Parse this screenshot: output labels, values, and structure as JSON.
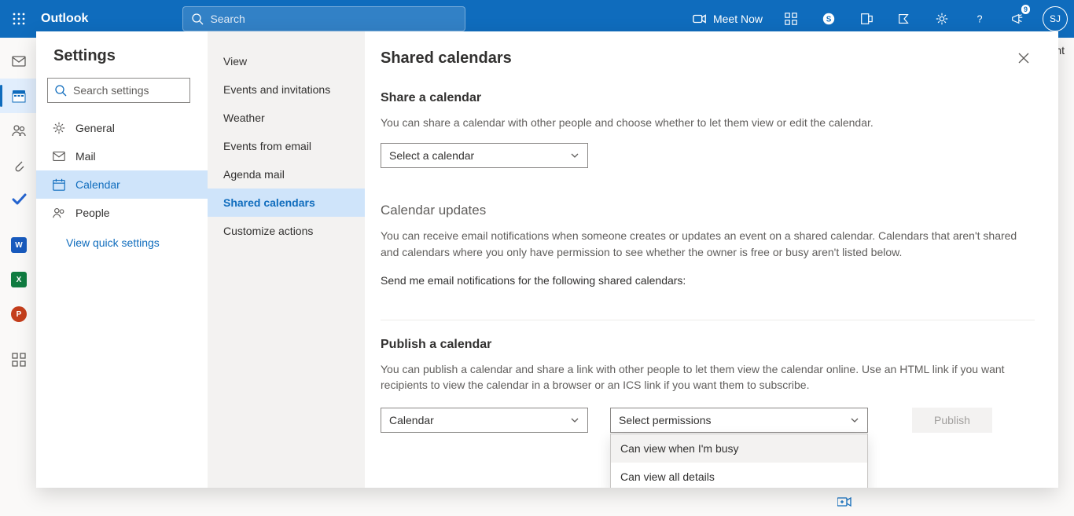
{
  "topbar": {
    "brand": "Outlook",
    "search_placeholder": "Search",
    "meet_now": "Meet Now",
    "notification_count": "9",
    "avatar_initials": "SJ"
  },
  "behind": {
    "print_label": "Print"
  },
  "settings": {
    "title": "Settings",
    "search_placeholder": "Search settings",
    "categories": [
      {
        "id": "general",
        "label": "General"
      },
      {
        "id": "mail",
        "label": "Mail"
      },
      {
        "id": "calendar",
        "label": "Calendar"
      },
      {
        "id": "people",
        "label": "People"
      }
    ],
    "quick_settings_link": "View quick settings",
    "sub_items": [
      "View",
      "Events and invitations",
      "Weather",
      "Events from email",
      "Agenda mail",
      "Shared calendars",
      "Customize actions"
    ],
    "selected_sub_index": 5
  },
  "panel": {
    "title": "Shared calendars",
    "share": {
      "heading": "Share a calendar",
      "desc": "You can share a calendar with other people and choose whether to let them view or edit the calendar.",
      "select_placeholder": "Select a calendar"
    },
    "updates": {
      "heading": "Calendar updates",
      "desc": "You can receive email notifications when someone creates or updates an event on a shared calendar. Calendars that aren't shared and calendars where you only have permission to see whether the owner is free or busy aren't listed below.",
      "prompt": "Send me email notifications for the following shared calendars:"
    },
    "publish": {
      "heading": "Publish a calendar",
      "desc": "You can publish a calendar and share a link with other people to let them view the calendar online. Use an HTML link if you want recipients to view the calendar in a browser or an ICS link if you want them to subscribe.",
      "calendar_selected": "Calendar",
      "permission_placeholder": "Select permissions",
      "permission_options": [
        "Can view when I'm busy",
        "Can view all details"
      ],
      "publish_label": "Publish"
    }
  }
}
